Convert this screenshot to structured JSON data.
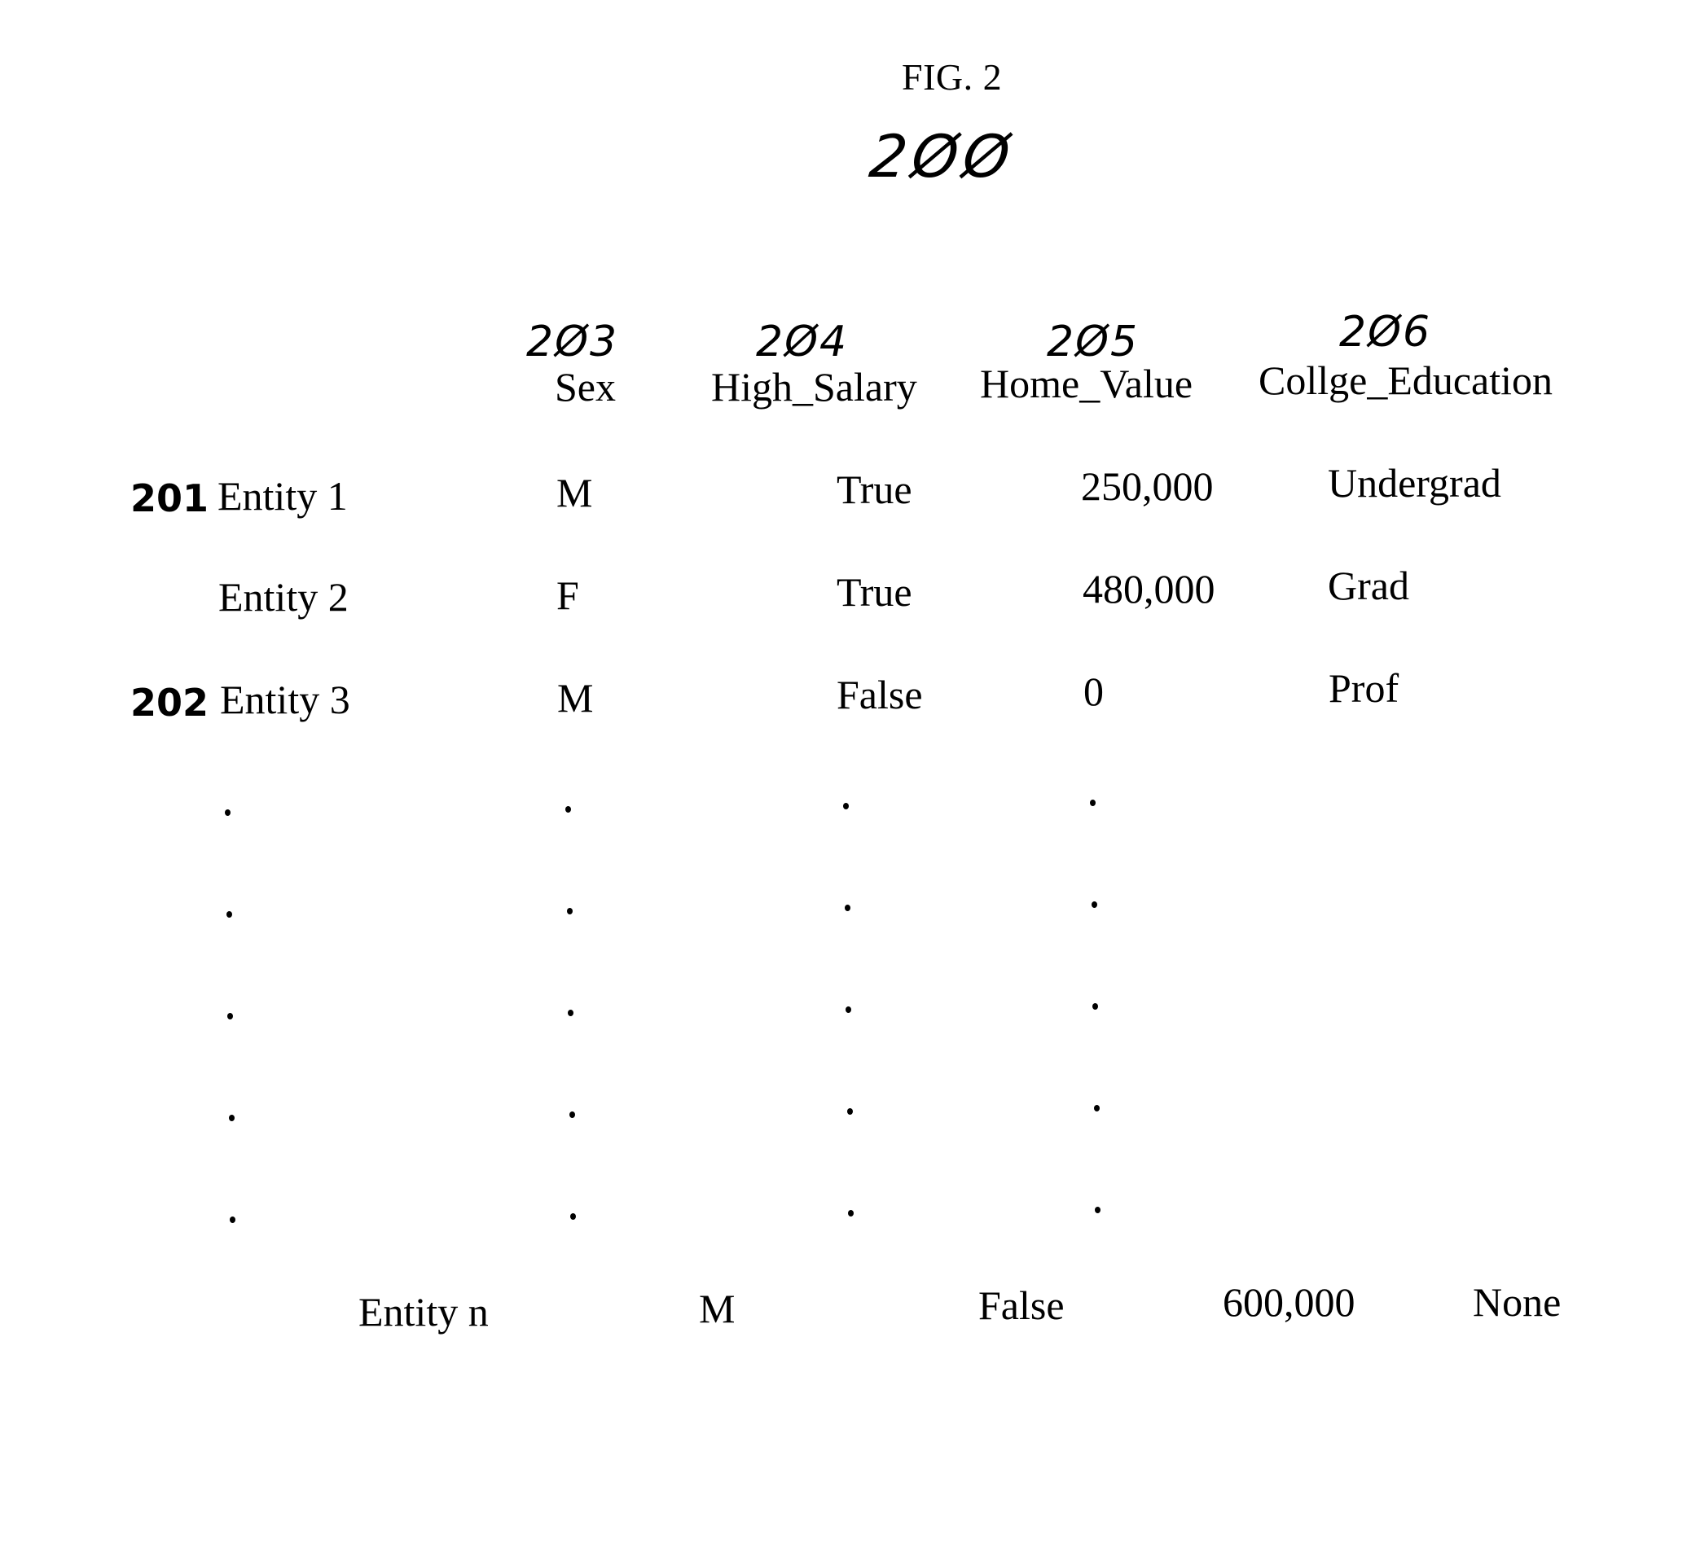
{
  "figure": {
    "title": "FIG. 2",
    "reference_number": "2ØØ"
  },
  "table": {
    "columns": [
      {
        "ref": "2Ø3",
        "label": "Sex"
      },
      {
        "ref": "2Ø4",
        "label": "High_Salary"
      },
      {
        "ref": "2Ø5",
        "label": "Home_Value"
      },
      {
        "ref": "2Ø6",
        "label": "Collge_Education"
      }
    ],
    "rows": [
      {
        "ref": "201",
        "entity": "Entity 1",
        "sex": "M",
        "high_salary": "True",
        "home_value": "250,000",
        "college_education": "Undergrad"
      },
      {
        "ref": "",
        "entity": "Entity 2",
        "sex": "F",
        "high_salary": "True",
        "home_value": "480,000",
        "college_education": "Grad"
      },
      {
        "ref": "202",
        "entity": "Entity 3",
        "sex": "M",
        "high_salary": "False",
        "home_value": "0",
        "college_education": "Prof"
      }
    ],
    "ellipsis_rows": 5,
    "last_row": {
      "entity": "Entity n",
      "sex": "M",
      "high_salary": "False",
      "home_value": "600,000",
      "college_education": "None"
    }
  }
}
